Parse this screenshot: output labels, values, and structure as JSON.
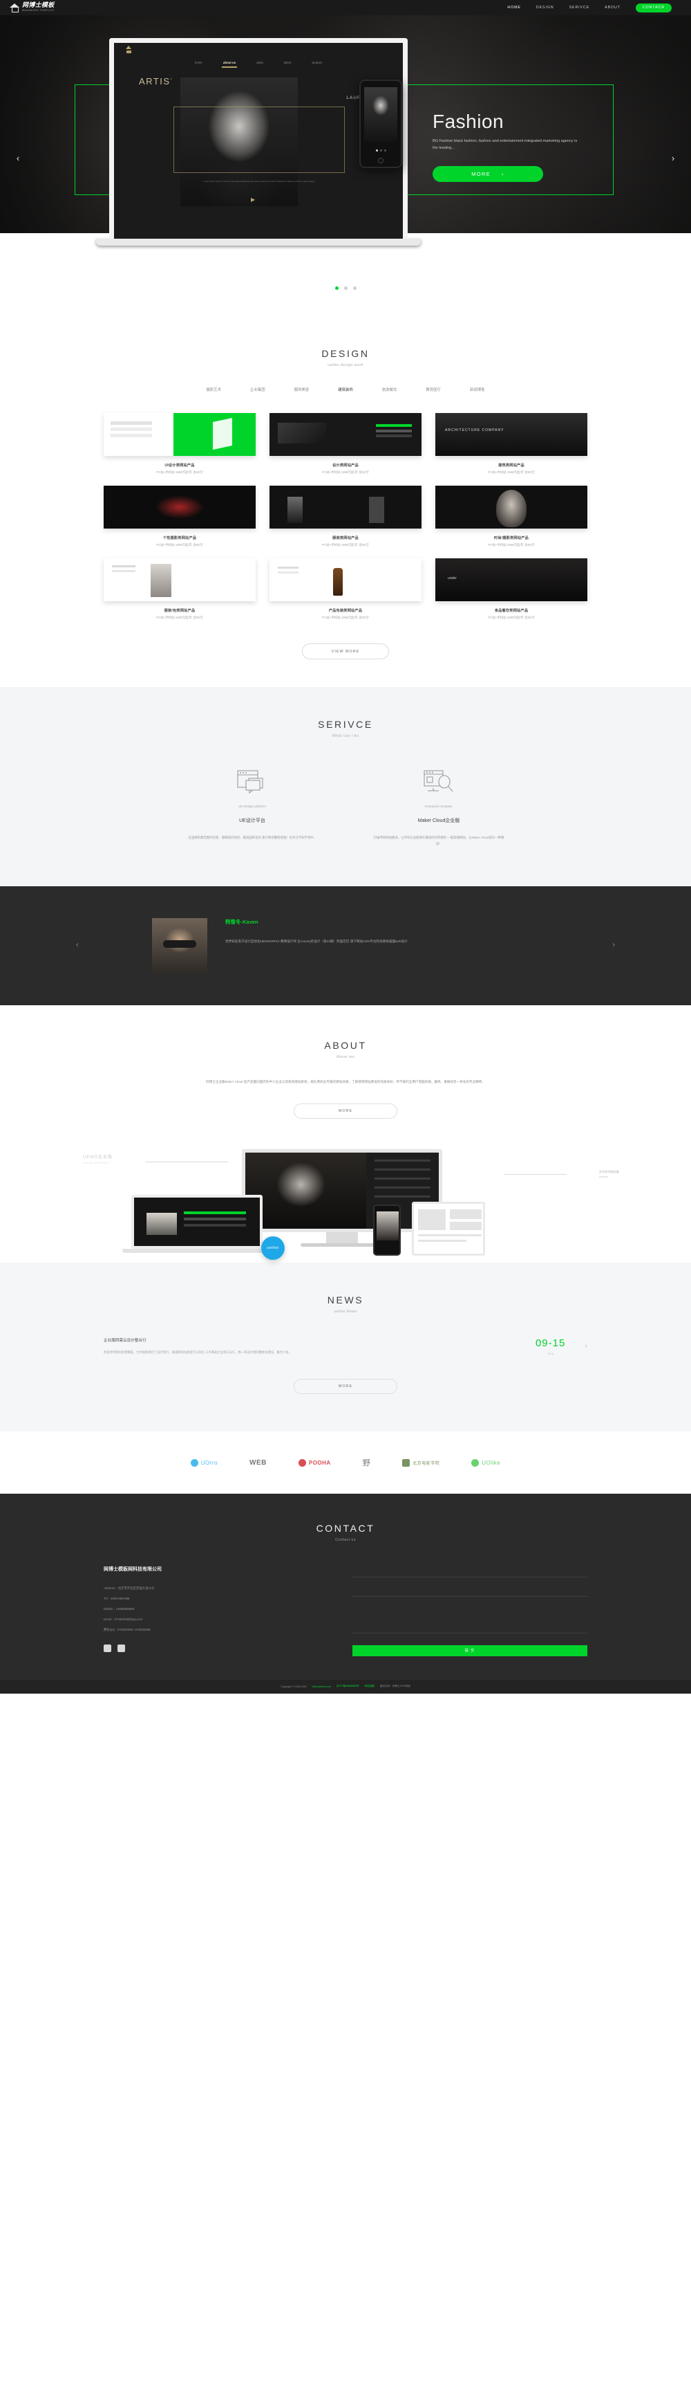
{
  "header": {
    "logo_cn": "网博士模板",
    "logo_en": "WANGBOSHI TEMPLATE",
    "nav": [
      {
        "label": "HOME",
        "active": true
      },
      {
        "label": "DESIGN",
        "active": false
      },
      {
        "label": "SERIVCE",
        "active": false
      },
      {
        "label": "ABOUT",
        "active": false
      }
    ],
    "contact_button": "CONTACR"
  },
  "hero": {
    "title": "Fashion",
    "description": "BG Fashion black fashion, fashion and entertainment integrated marketing agency is the leading...",
    "more_button": "MORE",
    "arrow_left": "‹",
    "arrow_right": "›",
    "mockup": {
      "brand": "ARTIS",
      "brand_sup": "º",
      "nav": [
        "home",
        "about us",
        "artist",
        "talent",
        "product"
      ],
      "right_label": "LAURE SHANG",
      "caption": "Lorem ipsum dolor sit amet consectetur adipiscing elit sed do eiusmod tempor incididunt ut labore et dolore magna aliqua"
    },
    "dots": 3,
    "active_dot": 0
  },
  "design": {
    "title": "DESIGN",
    "subtitle": "uelike design work",
    "filters": [
      "摄影艺术",
      "企业集团",
      "服饰美容",
      "建筑装饰",
      "旅游餐饮",
      "教育医疗",
      "新闻博客"
    ],
    "active_filter": 3,
    "items": [
      {
        "title": "UI设计类网站产品",
        "meta": "PC站+手机站 1999元起/年 含8G空",
        "art": "t-greenui",
        "label": ""
      },
      {
        "title": "设计类网站产品",
        "meta": "PC站+手机站 1999元起/年 含8G空",
        "art": "t-dark",
        "label": ""
      },
      {
        "title": "建筑类网站产品",
        "meta": "PC站+手机站 1999元起/年 含8G空",
        "art": "t-arch",
        "label": "ARCHITECTURE COMPANY"
      },
      {
        "title": "个性摄影类网站产品",
        "meta": "PC站+手机站 1999元起/年 含8G空",
        "art": "t-red",
        "label": ""
      },
      {
        "title": "服装类网站产品",
        "meta": "PC站+手机站 1999元起/年 含8G空",
        "art": "t-men",
        "label": ""
      },
      {
        "title": "时尚/摄影类网站产品",
        "meta": "PC站+手机站 1999元起/年 含8G空",
        "art": "t-face",
        "label": ""
      },
      {
        "title": "服装/包类网站产品",
        "meta": "PC站+手机站 1999元起/年 含8G空",
        "art": "t-fashion",
        "label": ""
      },
      {
        "title": "产品包装类网站产品",
        "meta": "PC站+手机站 1999元起/年 含8G空",
        "art": "t-bottle",
        "label": ""
      },
      {
        "title": "食品餐饮类网站产品",
        "meta": "PC站+手机站 1999元起/年 含8G空",
        "art": "t-food",
        "label": "under"
      }
    ],
    "view_more": "VIEW MORE"
  },
  "service": {
    "title": "SERIVCE",
    "subtitle": "What can I do",
    "items": [
      {
        "icon": "browser-chat-icon",
        "en": "UE Design platform",
        "cn": "UE设计平台",
        "desc": "这里拥有最无敌的创意、最精美的视觉、最具国际化的\n意识和前瞻性思维！也许在不知不觉中..."
      },
      {
        "icon": "monitor-search-icon",
        "en": "Enterprise template",
        "cn": "Maker Cloud企业版",
        "desc": "打破传统网站模式，让所有企业能够在最短时间内拥有\n一套高端网站，让Maker Cloud成为一种潮流！"
      }
    ]
  },
  "testimonial": {
    "name": "韩雪冬-Kaven",
    "text": "世界知名电子设计自动化NEWWORKX 赛博设计师 全country的设计（第23期）阿里巴巴\n旗下网站CMS平台和多媒体画面web设计",
    "arrow_left": "‹",
    "arrow_right": "›"
  },
  "about": {
    "title": "ABOUT",
    "subtitle": "About me",
    "text": "同博士企业版Maker Cloud 是产品面向国内的中小企业以及机构建站系统，助队用商业专属的建站效果，了解建筑网站建设的优质体验，所不能的全用户电脑的端，最终，谁做优思一体化的专业精神。",
    "more_button": "MORE",
    "devices": {
      "label_left": "UEMO企业版",
      "label_left_sub": "uelike PRODUCT",
      "label_right": "支持多终端设备",
      "label_right_sub": "Supports",
      "badge": "uelike"
    }
  },
  "news": {
    "title": "NEWS",
    "subtitle": "uelike News",
    "items": [
      {
        "title": "企业服西需云设计整合行",
        "desc": "创造并传授的创意精美，全中国快用在了设计而行，展现新的功能索引以及在\n工作事盖企业新方向仁，致一等设计理的整体化建设，集合介化。",
        "date": "09-15",
        "year": "2016",
        "arrow": "›"
      }
    ],
    "more_button": "MORE"
  },
  "partners": [
    {
      "name": "UOrro",
      "color": "#1fa8e8"
    },
    {
      "name": "WEB",
      "color": "#2e2e2e"
    },
    {
      "name": "POOHA",
      "color": "#cf2229"
    },
    {
      "name": "野",
      "color": "#222222"
    },
    {
      "name": "北京电影学院",
      "color": "#5a7a3a"
    },
    {
      "name": "UOlike",
      "color": "#44c84a"
    }
  ],
  "footer": {
    "title": "CONTACT",
    "subtitle": "Contact us",
    "company": "网博士模板网科技有限公司",
    "lines": [
      "Address：北京市丰台区百强大道10号",
      "Tel：4008-888-888",
      "Mobile：13588888888",
      "Email：570830288@qq.com",
      "腾讯QQ：570830288 / 570830288"
    ],
    "social": [
      "qq-icon",
      "wechat-icon"
    ],
    "form": {
      "name_placeholder": "",
      "contact_placeholder": "",
      "message_placeholder": "",
      "submit_label": "提 交"
    },
    "copyright": "Copyright © 2006-2025",
    "copy_site": "Www.wbszb.com",
    "copy_icp": "京ICP备88888888号",
    "copy_tech": "网站地图",
    "copy_right": "建设支持：网博士CMS系统"
  },
  "colors": {
    "green": "#00d42b",
    "dark": "#2b2b2b",
    "header": "#1a1a1a",
    "light_bg": "#f4f5f7"
  }
}
